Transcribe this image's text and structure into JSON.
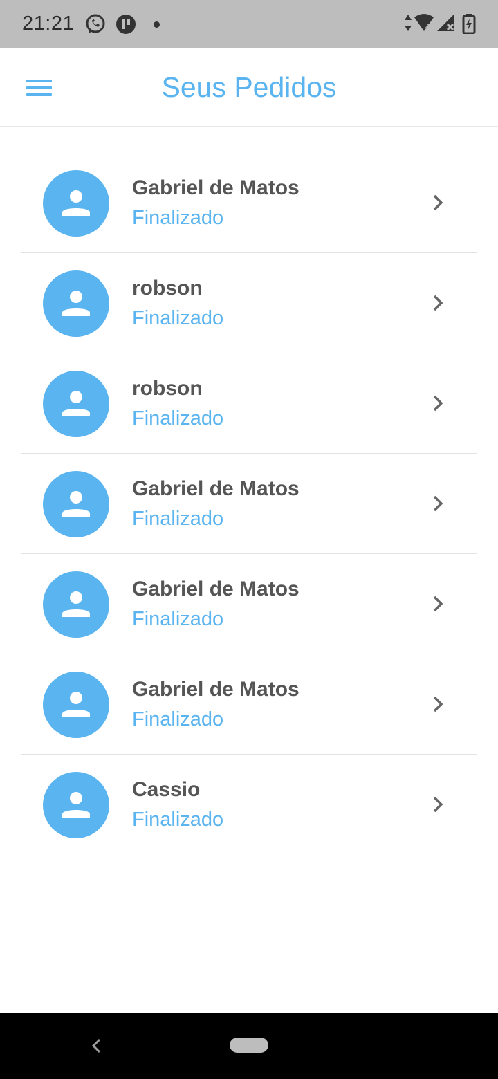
{
  "status_bar": {
    "time": "21:21",
    "icons": [
      "whatsapp-icon",
      "notification-app-icon",
      "dot-icon",
      "data-arrows-icon",
      "wifi-icon",
      "signal-icon",
      "battery-charging-icon"
    ]
  },
  "app_bar": {
    "title": "Seus Pedidos",
    "menu_icon": "hamburger-menu-icon"
  },
  "orders": [
    {
      "name": "Gabriel de Matos",
      "status": "Finalizado"
    },
    {
      "name": "robson",
      "status": "Finalizado"
    },
    {
      "name": "robson",
      "status": "Finalizado"
    },
    {
      "name": "Gabriel de Matos",
      "status": "Finalizado"
    },
    {
      "name": "Gabriel de Matos",
      "status": "Finalizado"
    },
    {
      "name": "Gabriel de Matos",
      "status": "Finalizado"
    },
    {
      "name": "Cassio",
      "status": "Finalizado"
    }
  ],
  "colors": {
    "accent": "#5ab4ef",
    "name_text": "#555555",
    "status_bar": "#bdbdbd",
    "nav_bar": "#000000"
  },
  "nav_bar": {
    "icons": [
      "back-icon",
      "home-pill-icon"
    ]
  }
}
